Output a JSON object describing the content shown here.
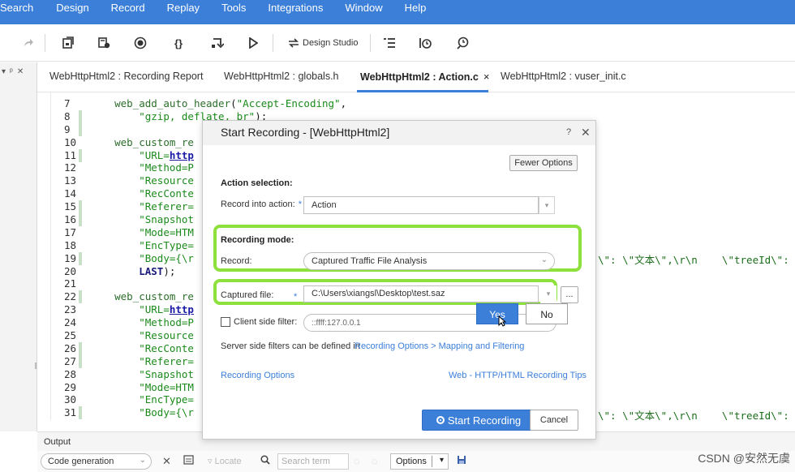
{
  "menu": [
    "Search",
    "Design",
    "Record",
    "Replay",
    "Tools",
    "Integrations",
    "Window",
    "Help"
  ],
  "toolbar": {
    "design_studio_label": "Design Studio",
    "icons": [
      "forward-arrow-icon",
      "save-script-icon",
      "record-list-icon",
      "record-icon",
      "braces-icon",
      "step-icon",
      "run-icon",
      "design-studio-icon",
      "list-icon",
      "timer-icon",
      "search-timer-icon"
    ]
  },
  "tabs": [
    {
      "label": "WebHttpHtml2 : Recording Report",
      "active": false
    },
    {
      "label": "WebHttpHtml2 : globals.h",
      "active": false
    },
    {
      "label": "WebHttpHtml2 : Action.c",
      "active": true
    },
    {
      "label": "WebHttpHtml2 : vuser_init.c",
      "active": false
    }
  ],
  "active_tab_close": "×",
  "editor": {
    "line_numbers": [
      "7",
      "8",
      "9",
      "10",
      "11",
      "12",
      "13",
      "14",
      "15",
      "16",
      "17",
      "18",
      "19",
      "20",
      "21",
      "22",
      "23",
      "24",
      "25",
      "26",
      "27",
      "28",
      "29",
      "30",
      "31"
    ],
    "right_fragment_1": "\\\": \\\"文本\\\",\\r\\n    \\\"treeId\\\":",
    "right_fragment_2": "\\\": \\\"文本\\\",\\r\\n    \\\"treeId\\\":"
  },
  "output": {
    "header": "Output",
    "selected_view": "Code generation",
    "locate_label": "Locate",
    "search_placeholder": "Search term",
    "options_label": "Options"
  },
  "dialog": {
    "title": "Start Recording - [WebHttpHtml2]",
    "help": "?",
    "close": "✕",
    "fewer_options": "Fewer Options",
    "action_selection_heading": "Action selection:",
    "record_into_action_label": "Record into action:",
    "required_mark": "*",
    "action_value": "Action",
    "recording_mode_heading": "Recording mode:",
    "record_label": "Record:",
    "record_value": "Captured Traffic File Analysis",
    "captured_file_label": "Captured file:",
    "captured_file_value": "C:\\Users\\xiangsl\\Desktop\\test.saz",
    "browse_label": "...",
    "client_filter_label": "Client side filter:",
    "client_filter_value": "::ffff:127.0.0.1",
    "server_filter_text": "Server side filters can be defined in",
    "server_filter_link": "Recording Options > Mapping and Filtering",
    "recording_options_link": "Recording Options",
    "tips_link": "Web - HTTP/HTML Recording Tips",
    "start_recording": "Start Recording",
    "cancel": "Cancel"
  },
  "popup": {
    "yes": "Yes",
    "no": "No"
  },
  "watermark": "CSDN @安然无虞",
  "colors": {
    "accent": "#3b7fd9",
    "highlight": "#8ee03c"
  }
}
